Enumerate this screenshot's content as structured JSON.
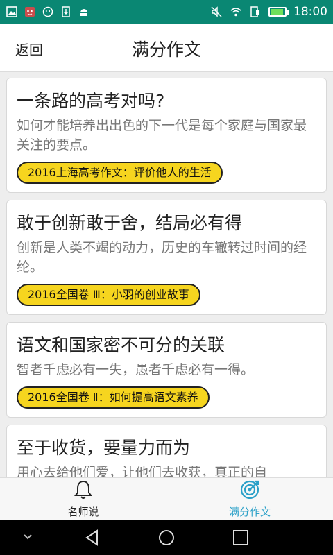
{
  "status": {
    "time": "18:00"
  },
  "header": {
    "back_label": "返回",
    "title": "满分作文"
  },
  "articles": [
    {
      "title": "一条路的高考对吗?",
      "desc": "如何才能培养出出色的下一代是每个家庭与国家最关注的要点。",
      "tag": "2016上海高考作文：评价他人的生活"
    },
    {
      "title": "敢于创新敢于舍，结局必有得",
      "desc": "创新是人类不竭的动力，历史的车辙转过时间的经纶。",
      "tag": "2016全国卷 Ⅲ：小羽的创业故事"
    },
    {
      "title": "语文和国家密不可分的关联",
      "desc": "智者千虑必有一失，愚者千虑必有一得。",
      "tag": "2016全国卷 Ⅱ：如何提高语文素养"
    },
    {
      "title": "至于收货，要量力而为",
      "desc": "用心去给他们爱，让他们去收获，真正的自",
      "tag": ""
    }
  ],
  "tabs": [
    {
      "label": "名师说",
      "icon": "bell-icon",
      "active": false
    },
    {
      "label": "满分作文",
      "icon": "target-icon",
      "active": true
    }
  ],
  "colors": {
    "status_bar": "#0a8773",
    "tag_bg": "#f6d51f",
    "active_tab": "#2aa0c8"
  }
}
